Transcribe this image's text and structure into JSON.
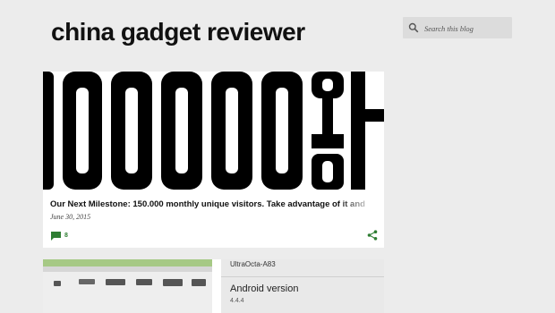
{
  "header": {
    "blog_title": "china gadget reviewer"
  },
  "search": {
    "placeholder": "Search this blog"
  },
  "post": {
    "title": "Our Next Milestone: 150.000 monthly unique visitors. Take advantage of it and",
    "date": "June 30, 2015",
    "comment_count": "8",
    "hero_text": "0000+"
  },
  "next_post": {
    "model": "UltraOcta-A83",
    "android_label": "Android version",
    "android_version": "4.4.4"
  },
  "colors": {
    "background": "#ececec",
    "accent_green": "#2e7d32"
  }
}
